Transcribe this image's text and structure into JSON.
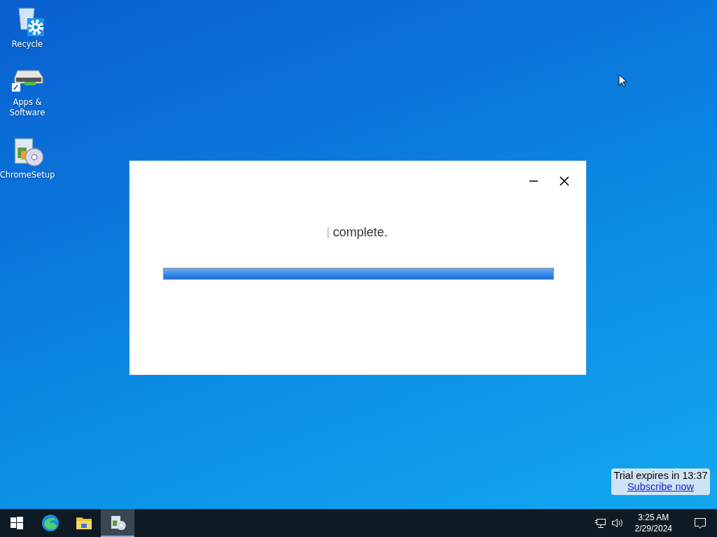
{
  "desktop_icons": [
    {
      "kind": "recycle",
      "label": "Recycle"
    },
    {
      "kind": "drive",
      "label": "Apps &\nSoftware"
    },
    {
      "kind": "setup",
      "label": "ChromeSetup"
    }
  ],
  "window": {
    "status": "complete.",
    "progress": {
      "level": 1
    }
  },
  "trial": {
    "text": "Trial expires in 13:37",
    "link": "Subscribe now"
  },
  "taskbar": {
    "apps": [
      {
        "kind": "edge",
        "selected": false
      },
      {
        "kind": "folder",
        "selected": false
      },
      {
        "kind": "setup",
        "selected": true
      }
    ],
    "clock": {
      "time": "3:25 AM",
      "date": "2/29/2024"
    }
  }
}
